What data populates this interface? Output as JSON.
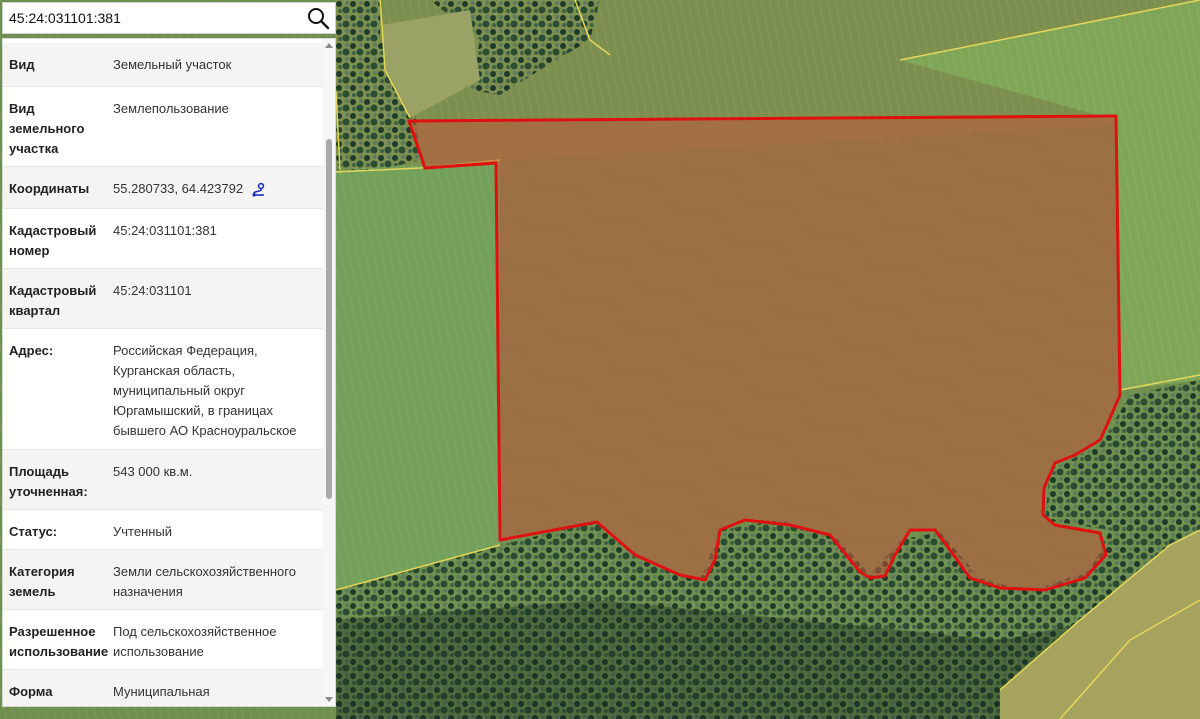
{
  "search": {
    "value": "45:24:031101:381"
  },
  "icons": {
    "search": "search-icon",
    "coordinates": "map-route-icon",
    "coordinates_color": "#1a2fbf"
  },
  "map": {
    "parcel_outline_color": "#e01010",
    "parcel_fill_color": "#c0553a",
    "boundary_color": "#e5d65a"
  },
  "info": {
    "rows": [
      {
        "label": "Вид",
        "value": "Земельный участок"
      },
      {
        "label": "Вид земельного участка",
        "value": "Землепользование"
      },
      {
        "label": "Координаты",
        "value": "55.280733, 64.423792"
      },
      {
        "label": "Кадастровый номер",
        "value": "45:24:031101:381"
      },
      {
        "label": "Кадастровый квартал",
        "value": "45:24:031101"
      },
      {
        "label": "Адрес:",
        "value": "Российская Федерация, Курганская область, муниципальный округ Юргамышский, в границах бывшего АО Красноуральское"
      },
      {
        "label": "Площадь уточненная:",
        "value": "543 000 кв.м."
      },
      {
        "label": "Статус:",
        "value": "Учтенный"
      },
      {
        "label": "Категория земель",
        "value": "Земли сельскохозяйственного назначения"
      },
      {
        "label": "Разрешенное использование",
        "value": "Под сельскохозяйственное использование"
      },
      {
        "label": "Форма собственности",
        "value": "Муниципальная"
      }
    ]
  }
}
